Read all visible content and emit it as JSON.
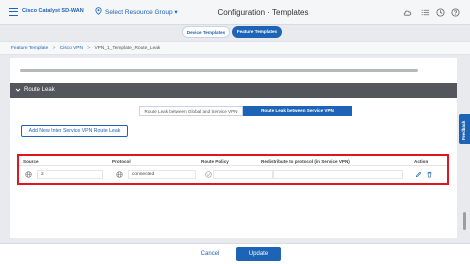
{
  "header": {
    "brand": "Cisco Catalyst SD-WAN",
    "resource_group": "Select Resource Group",
    "resource_group_caret": "▾",
    "title": "Configuration · Templates"
  },
  "template_tabs": [
    {
      "label": "Device Templates",
      "active": false
    },
    {
      "label": "Feature Templates",
      "active": true
    }
  ],
  "breadcrumb": [
    "Feature Template",
    "Cisco VPN",
    "VPN_1_Template_Route_Leak"
  ],
  "breadcrumb_sep": ">",
  "section": {
    "title": "Route Leak",
    "expanded": true
  },
  "route_leak_tabs": [
    {
      "label": "Route Leak between Global and Service VPN",
      "active": false
    },
    {
      "label": "Route Leak between Service VPN",
      "active": true
    }
  ],
  "add_button_label": "Add New Inter Service VPN Route Leak",
  "table": {
    "columns": [
      "Source",
      "Protocol",
      "Route Policy",
      "Redistribute to protocol (in Service VPN)",
      "Action"
    ],
    "rows": [
      {
        "source": "2",
        "protocol": "connected"
      }
    ]
  },
  "feedback_label": "Feedback",
  "footer": {
    "cancel_label": "Cancel",
    "update_label": "Update"
  },
  "colors": {
    "accent": "#1d63b6",
    "highlight": "#e0151f",
    "section_header": "#53575d"
  }
}
